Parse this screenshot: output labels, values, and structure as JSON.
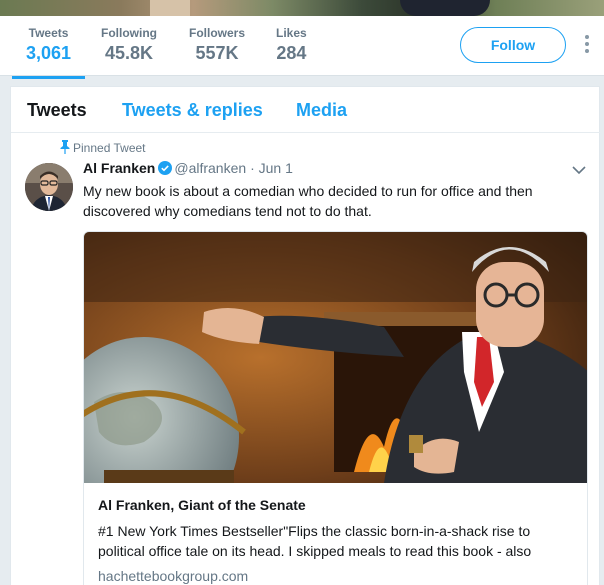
{
  "profile_nav": {
    "stats": [
      {
        "label": "Tweets",
        "value": "3,061"
      },
      {
        "label": "Following",
        "value": "45.8K"
      },
      {
        "label": "Followers",
        "value": "557K"
      },
      {
        "label": "Likes",
        "value": "284"
      }
    ],
    "follow_label": "Follow"
  },
  "tabs": [
    "Tweets",
    "Tweets & replies",
    "Media"
  ],
  "tweet": {
    "pinned_label": "Pinned Tweet",
    "author_name": "Al Franken",
    "handle": "@alfranken",
    "separator": "·",
    "date": "Jun 1",
    "text": "My new book is about a comedian who decided to run for office and then discovered why comedians tend not to do that.",
    "card": {
      "title": "Al Franken, Giant of the Senate",
      "description": "#1 New York Times Bestseller\"Flips the classic born-in-a-shack rise to political office tale on its head. I skipped meals to read this book - also",
      "domain": "hachettebookgroup.com"
    }
  },
  "colors": {
    "accent": "#1da1f2",
    "secondary_text": "#657786",
    "primary_text": "#14171a",
    "page_bg": "#e6ecf0"
  }
}
